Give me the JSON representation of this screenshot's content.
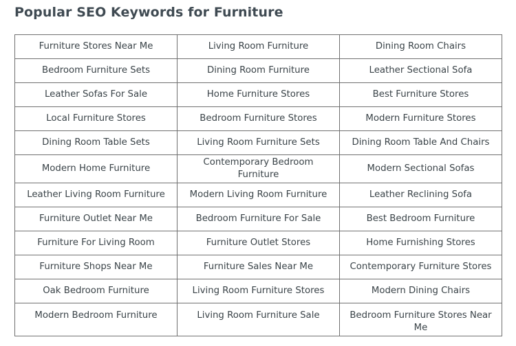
{
  "page": {
    "title": "Popular SEO Keywords for Furniture",
    "title_color": "#3f4a52",
    "background_color": "#ffffff",
    "text_color": "#3a4348",
    "border_color": "#6f6f6f"
  },
  "keyword_table": {
    "columns": 3,
    "rows": 12,
    "cells": [
      [
        "Furniture Stores Near Me",
        "Living Room Furniture",
        "Dining Room Chairs"
      ],
      [
        "Bedroom Furniture Sets",
        "Dining Room Furniture",
        "Leather Sectional Sofa"
      ],
      [
        "Leather Sofas For Sale",
        "Home Furniture Stores",
        "Best Furniture Stores"
      ],
      [
        "Local Furniture Stores",
        "Bedroom Furniture Stores",
        "Modern Furniture Stores"
      ],
      [
        "Dining Room Table Sets",
        "Living Room Furniture Sets",
        "Dining Room Table And Chairs"
      ],
      [
        "Modern Home Furniture",
        "Contemporary Bedroom Furniture",
        "Modern Sectional Sofas"
      ],
      [
        "Leather Living Room Furniture",
        "Modern Living Room Furniture",
        "Leather Reclining Sofa"
      ],
      [
        "Furniture Outlet Near Me",
        "Bedroom Furniture For Sale",
        "Best Bedroom Furniture"
      ],
      [
        "Furniture For Living Room",
        "Furniture Outlet Stores",
        "Home Furnishing Stores"
      ],
      [
        "Furniture Shops Near Me",
        "Furniture Sales Near Me",
        "Contemporary Furniture Stores"
      ],
      [
        "Oak Bedroom Furniture",
        "Living Room Furniture Stores",
        "Modern Dining Chairs"
      ],
      [
        "Modern Bedroom Furniture",
        "Living Room Furniture Sale",
        "Bedroom Furniture Stores Near Me"
      ]
    ]
  }
}
